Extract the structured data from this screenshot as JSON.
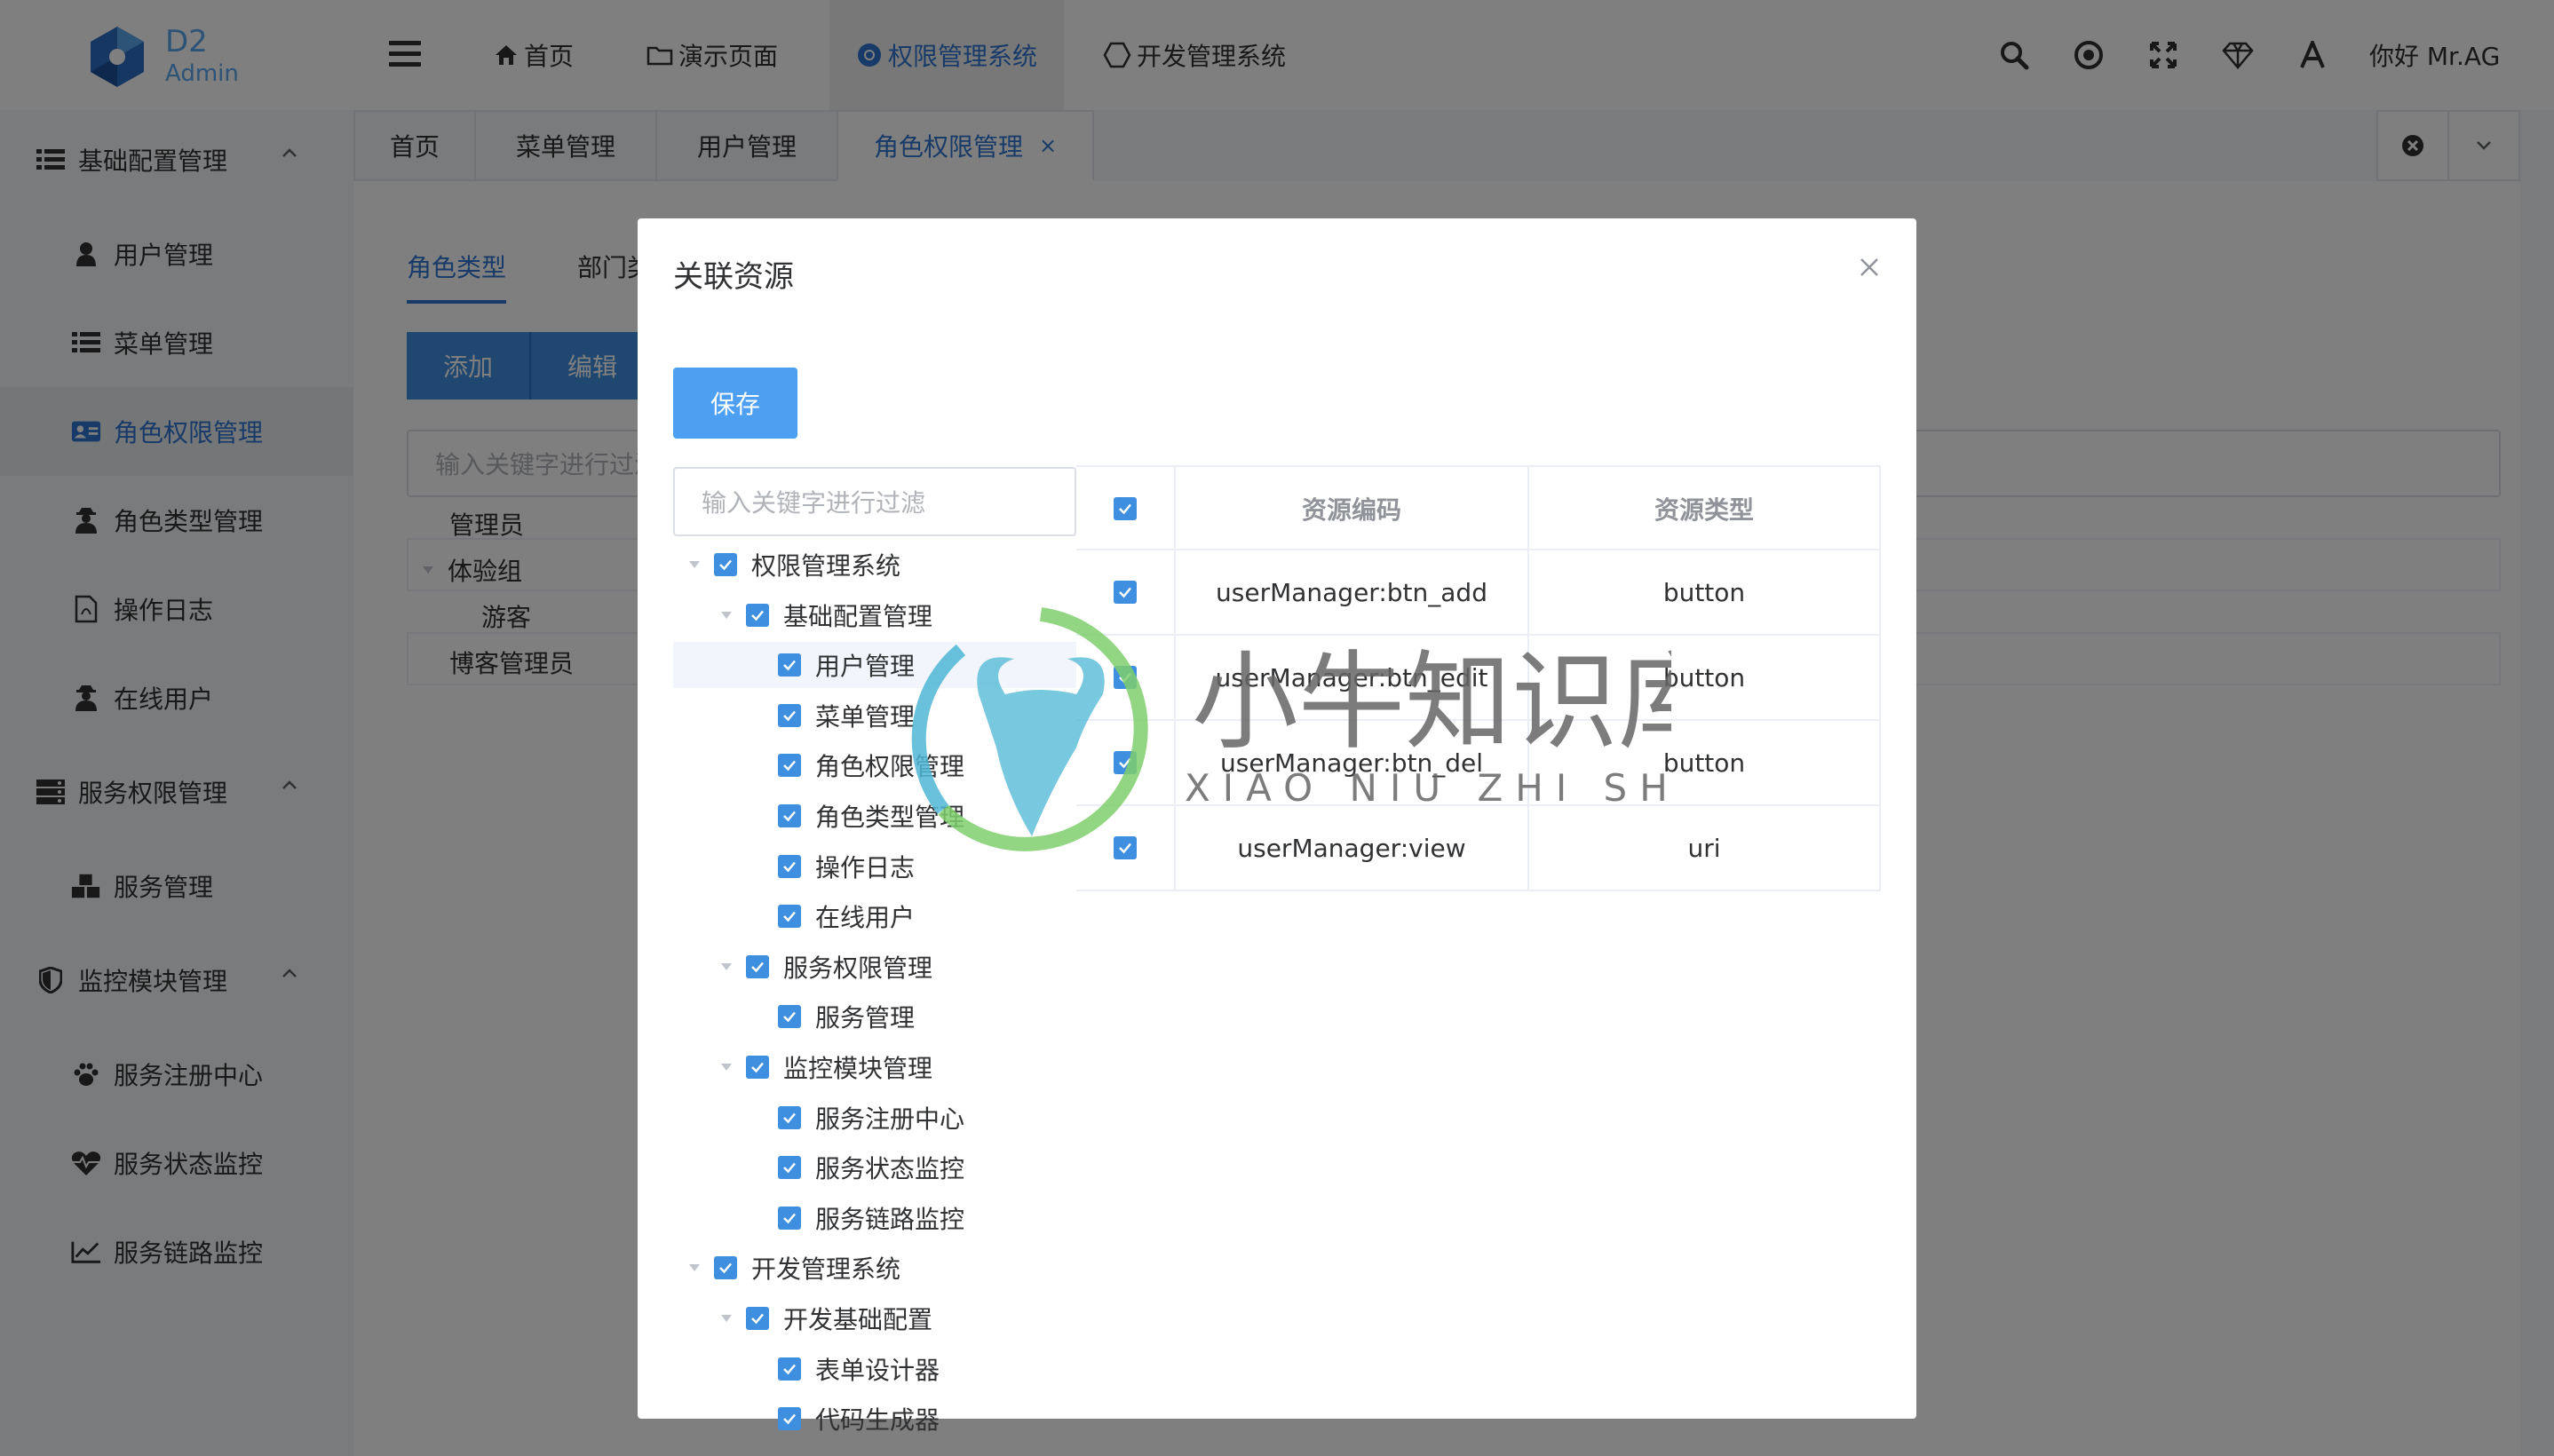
{
  "logo": {
    "line1": "D2",
    "line2": "Admin"
  },
  "header": {
    "menus": [
      {
        "label": "首页",
        "icon": "home-icon"
      },
      {
        "label": "演示页面",
        "icon": "folder-icon"
      },
      {
        "label": "权限管理系统",
        "icon": "chrome-icon"
      },
      {
        "label": "开发管理系统",
        "icon": "hexagon-icon"
      }
    ],
    "icons": [
      "search-icon",
      "record-icon",
      "fullscreen-icon",
      "diamond-icon",
      "font-icon"
    ],
    "greeting": "你好 Mr.AG"
  },
  "sidebar": {
    "items": [
      {
        "label": "基础配置管理",
        "icon": "list-icon"
      },
      {
        "label": "用户管理",
        "icon": "user-icon"
      },
      {
        "label": "菜单管理",
        "icon": "list-icon"
      },
      {
        "label": "角色权限管理",
        "icon": "id-card-icon"
      },
      {
        "label": "角色类型管理",
        "icon": "user-secret-icon"
      },
      {
        "label": "操作日志",
        "icon": "file-icon"
      },
      {
        "label": "在线用户",
        "icon": "user-secret-icon"
      },
      {
        "label": "服务权限管理",
        "icon": "server-icon"
      },
      {
        "label": "服务管理",
        "icon": "cubes-icon"
      },
      {
        "label": "监控模块管理",
        "icon": "shield-icon"
      },
      {
        "label": "服务注册中心",
        "icon": "paw-icon"
      },
      {
        "label": "服务状态监控",
        "icon": "heartbeat-icon"
      },
      {
        "label": "服务链路监控",
        "icon": "line-chart-icon"
      }
    ]
  },
  "tabs": [
    "首页",
    "菜单管理",
    "用户管理",
    "角色权限管理"
  ],
  "tab_close": "×",
  "main": {
    "subtabs": [
      "角色类型",
      "部门类"
    ],
    "add_label": "添加",
    "edit_label": "编辑",
    "filter_placeholder": "输入关键字进行过滤",
    "tree": [
      "管理员",
      "体验组",
      "游客",
      "博客管理员"
    ]
  },
  "dialog": {
    "title": "关联资源",
    "save_label": "保存",
    "filter_placeholder": "输入关键字进行过滤",
    "tree": [
      {
        "label": "权限管理系统",
        "level": 0
      },
      {
        "label": "基础配置管理",
        "level": 1
      },
      {
        "label": "用户管理",
        "level": 2
      },
      {
        "label": "菜单管理",
        "level": 2
      },
      {
        "label": "角色权限管理",
        "level": 2
      },
      {
        "label": "角色类型管理",
        "level": 2
      },
      {
        "label": "操作日志",
        "level": 2
      },
      {
        "label": "在线用户",
        "level": 2
      },
      {
        "label": "服务权限管理",
        "level": 1
      },
      {
        "label": "服务管理",
        "level": 2
      },
      {
        "label": "监控模块管理",
        "level": 1
      },
      {
        "label": "服务注册中心",
        "level": 2
      },
      {
        "label": "服务状态监控",
        "level": 2
      },
      {
        "label": "服务链路监控",
        "level": 2
      },
      {
        "label": "开发管理系统",
        "level": 0
      },
      {
        "label": "开发基础配置",
        "level": 1
      },
      {
        "label": "表单设计器",
        "level": 2
      },
      {
        "label": "代码生成器",
        "level": 2
      }
    ],
    "table": {
      "headers": [
        "资源编码",
        "资源类型"
      ],
      "rows": [
        {
          "code": "userManager:btn_add",
          "type": "button"
        },
        {
          "code": "userManager:btn_edit",
          "type": "button"
        },
        {
          "code": "userManager:btn_del",
          "type": "button"
        },
        {
          "code": "userManager:view",
          "type": "uri"
        }
      ]
    }
  },
  "watermark": {
    "cn": "小牛知识库",
    "en": "XIAO NIU ZHI SHI KU"
  },
  "colors": {
    "accent": "#2f74d0",
    "checkbox": "#3f8fe0",
    "save_button": "#4d9ff2"
  }
}
